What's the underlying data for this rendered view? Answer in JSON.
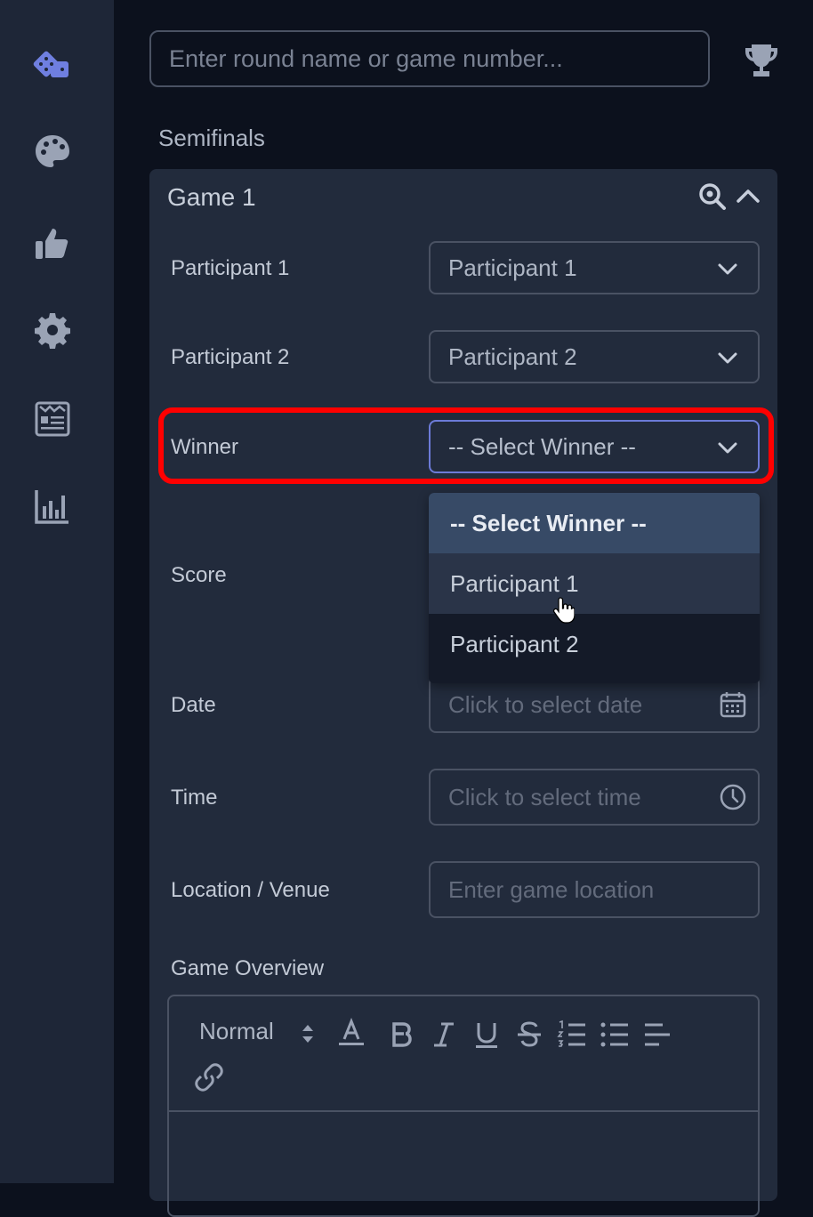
{
  "sidebar": {
    "items": [
      {
        "icon": "dice-icon",
        "active": true
      },
      {
        "icon": "palette-icon"
      },
      {
        "icon": "thumbs-up-icon"
      },
      {
        "icon": "gear-icon"
      },
      {
        "icon": "newspaper-icon"
      },
      {
        "icon": "bar-chart-icon"
      }
    ]
  },
  "search": {
    "placeholder": "Enter round name or game number..."
  },
  "round": {
    "title": "Semifinals"
  },
  "game": {
    "title": "Game 1",
    "participant1": {
      "label": "Participant 1",
      "value": "Participant 1"
    },
    "participant2": {
      "label": "Participant 2",
      "value": "Participant 2"
    },
    "winner": {
      "label": "Winner",
      "value": "-- Select Winner --",
      "options": [
        "-- Select Winner --",
        "Participant 1",
        "Participant 2"
      ]
    },
    "score": {
      "label": "Score"
    },
    "date": {
      "label": "Date",
      "placeholder": "Click to select date"
    },
    "time": {
      "label": "Time",
      "placeholder": "Click to select time"
    },
    "location": {
      "label": "Location / Venue",
      "placeholder": "Enter game location"
    },
    "overview": {
      "label": "Game Overview",
      "format": "Normal"
    }
  },
  "colors": {
    "accent": "#6c7bd8",
    "highlight": "#ff0000",
    "sidebar_bg": "#1e2637",
    "card_bg": "#222b3c"
  }
}
